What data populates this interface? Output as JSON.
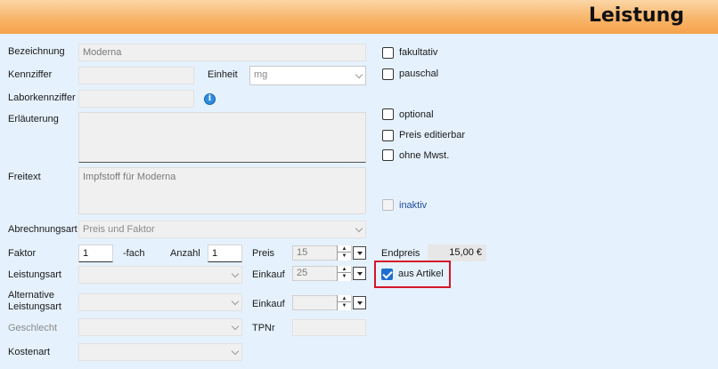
{
  "header": {
    "title": "Leistung"
  },
  "labels": {
    "bezeichnung": "Bezeichnung",
    "kennziffer": "Kennziffer",
    "einheit": "Einheit",
    "laborkennziffer": "Laborkennziffer",
    "erlaeuterung": "Erläuterung",
    "freitext": "Freitext",
    "abrechnungsart": "Abrechnungsart",
    "faktor": "Faktor",
    "fach": "-fach",
    "anzahl": "Anzahl",
    "preis": "Preis",
    "leistungsart": "Leistungsart",
    "einkauf": "Einkauf",
    "alternative_leistungsart": "Alternative Leistungsart",
    "einkauf2": "Einkauf",
    "geschlecht": "Geschlecht",
    "tpnr": "TPNr",
    "kostenart": "Kostenart",
    "endpreis": "Endpreis"
  },
  "fields": {
    "bezeichnung": "Moderna",
    "kennziffer": "",
    "einheit": "mg",
    "laborkennziffer": "",
    "erlaeuterung": "",
    "freitext": "Impfstoff für Moderna",
    "abrechnungsart": "Preis und Faktor",
    "faktor": "1",
    "anzahl": "1",
    "preis": "15",
    "leistungsart": "",
    "einkauf": "25",
    "alternative_leistungsart": "",
    "einkauf2": "",
    "geschlecht": "",
    "tpnr": "",
    "kostenart": "",
    "endpreis": "15,00 €"
  },
  "checkboxes": {
    "fakultativ": {
      "label": "fakultativ",
      "checked": false
    },
    "pauschal": {
      "label": "pauschal",
      "checked": false
    },
    "optional": {
      "label": "optional",
      "checked": false
    },
    "preis_editierbar": {
      "label": "Preis editierbar",
      "checked": false
    },
    "ohne_mwst": {
      "label": "ohne Mwst.",
      "checked": false
    },
    "inaktiv": {
      "label": "inaktiv",
      "checked": false
    },
    "aus_artikel": {
      "label": "aus Artikel",
      "checked": true
    }
  },
  "colors": {
    "accent": "#1f6fd1",
    "highlight": "#d4162b",
    "header_gradient": "#f6a24a",
    "background": "#e5f1fc"
  }
}
